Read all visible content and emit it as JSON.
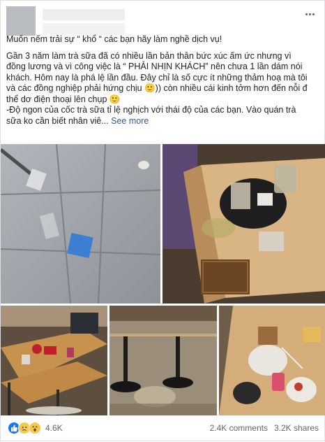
{
  "post": {
    "title_line": "Muốn nếm trải sự “ khổ “ các bạn hãy làm nghề dịch vụ!",
    "body_lines": [
      "Gần 3 năm làm trà sữa đã có nhiều lần bản thân bức xúc ấm ức nhưng vì",
      "đồng lương và vì công việc là “ PHẢI NHỊN KHÁCH” nên chưa 1 lần dám nói",
      "khách. Hôm nay là phá lệ lần đầu. Đây chỉ là số cực ít những thảm hoạ mà tôi",
      "và các đồng nghiệp phải hứng chịu 🙂)) còn nhiều cái kinh tởm hơn đến nỗi đ",
      "thể dơ điện thoại lên chụp 🙂",
      "-Độ ngon của cốc trà sữa tỉ lệ nghịch với thái độ của các bạn. Vào quán trà",
      "sữa ko cần biết nhân viê... "
    ],
    "see_more": "See more"
  },
  "footer": {
    "reaction_count": "4.6K",
    "comments": "2.4K comments",
    "shares": "3.2K shares"
  },
  "icons": [
    "more-options-icon",
    "like-reaction-icon",
    "sad-reaction-icon",
    "wow-reaction-icon"
  ],
  "colors": {
    "link": "#385898",
    "like": "#1877f2",
    "emoji": "#f7c94b",
    "muted": "#606770"
  }
}
